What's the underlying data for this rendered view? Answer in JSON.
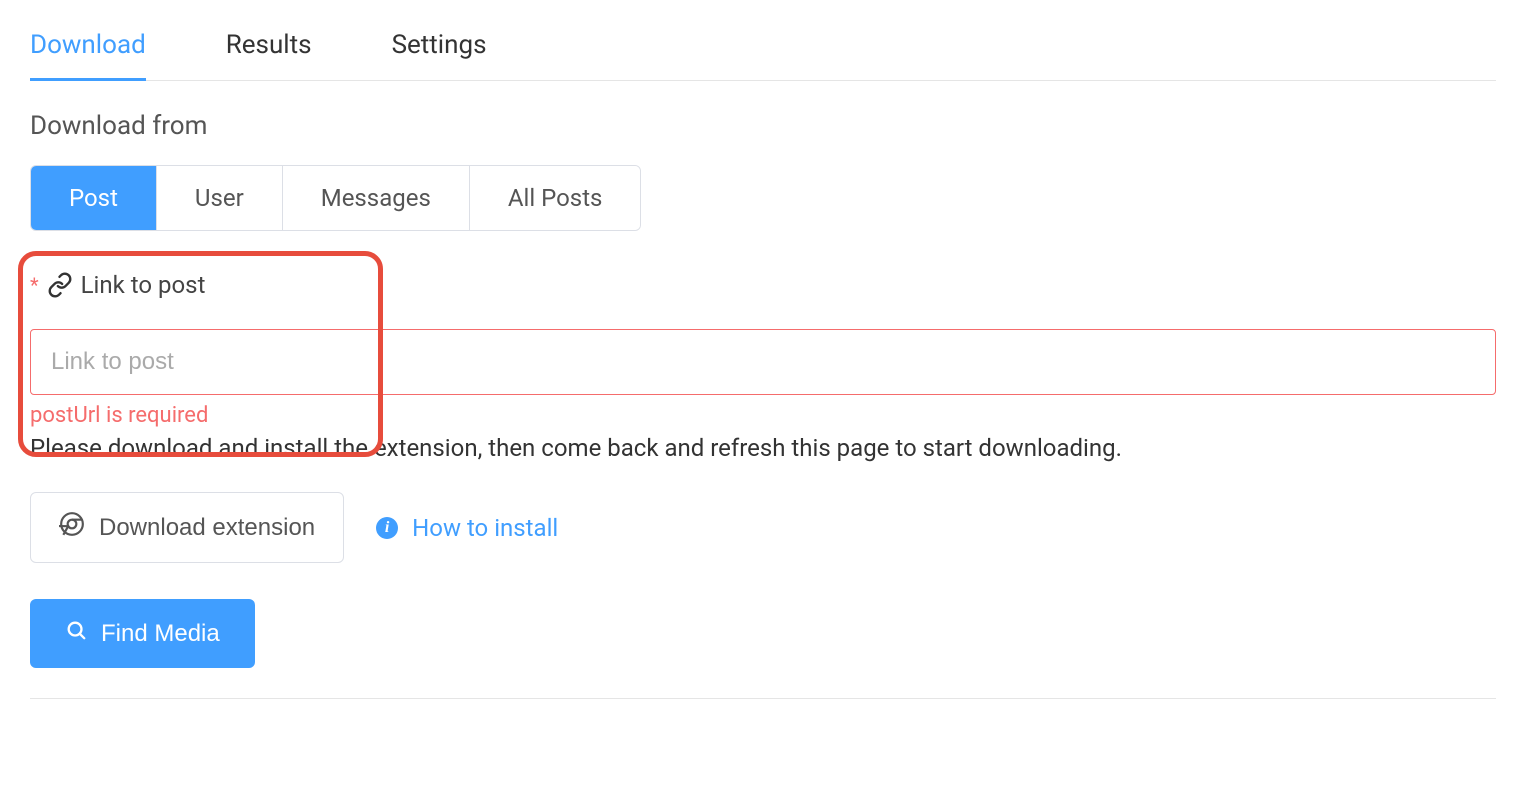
{
  "tabs": {
    "download": "Download",
    "results": "Results",
    "settings": "Settings"
  },
  "section_label": "Download from",
  "radio": {
    "post": "Post",
    "user": "User",
    "messages": "Messages",
    "all_posts": "All Posts"
  },
  "form": {
    "label": "Link to post",
    "placeholder": "Link to post",
    "error": "postUrl is required"
  },
  "instruction": "Please download and install the extension, then come back and refresh this page to start downloading.",
  "buttons": {
    "download_ext": "Download extension",
    "how_install": "How to install",
    "find_media": "Find Media"
  }
}
